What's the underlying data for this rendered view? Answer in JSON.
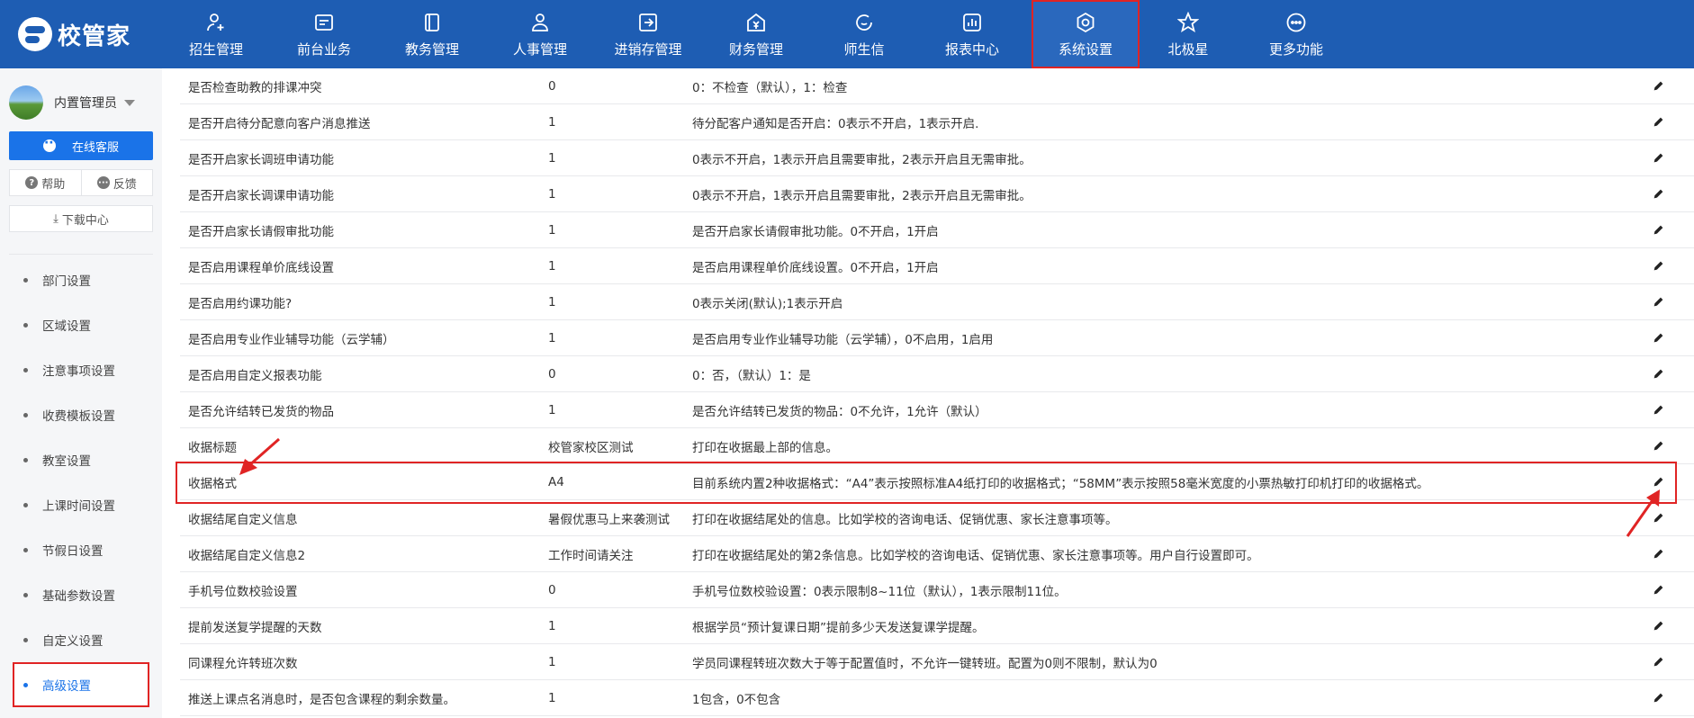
{
  "app": {
    "logo_text": "校管家"
  },
  "nav": [
    {
      "label": "招生管理",
      "icon": "user-add-icon"
    },
    {
      "label": "前台业务",
      "icon": "id-card-icon"
    },
    {
      "label": "教务管理",
      "icon": "book-icon"
    },
    {
      "label": "人事管理",
      "icon": "person-icon"
    },
    {
      "label": "进销存管理",
      "icon": "inventory-icon"
    },
    {
      "label": "财务管理",
      "icon": "finance-icon"
    },
    {
      "label": "师生信",
      "icon": "message-icon"
    },
    {
      "label": "报表中心",
      "icon": "report-icon"
    },
    {
      "label": "系统设置",
      "icon": "settings-icon",
      "active": true
    },
    {
      "label": "北极星",
      "icon": "star-icon"
    },
    {
      "label": "更多功能",
      "icon": "more-icon"
    }
  ],
  "sidebar": {
    "user_name": "内置管理员",
    "service_label": "在线客服",
    "help_label": "帮助",
    "feedback_label": "反馈",
    "download_label": "下载中心",
    "menu": [
      {
        "label": "部门设置"
      },
      {
        "label": "区域设置"
      },
      {
        "label": "注意事项设置"
      },
      {
        "label": "收费模板设置"
      },
      {
        "label": "教室设置"
      },
      {
        "label": "上课时间设置"
      },
      {
        "label": "节假日设置"
      },
      {
        "label": "基础参数设置"
      },
      {
        "label": "自定义设置"
      },
      {
        "label": "高级设置",
        "active": true
      }
    ]
  },
  "table": {
    "rows": [
      {
        "name": "是否检查助教的排课冲突",
        "value": "0",
        "desc": "0：不检查（默认），1：检查"
      },
      {
        "name": "是否开启待分配意向客户消息推送",
        "value": "1",
        "desc": "待分配客户通知是否开启：0表示不开启，1表示开启."
      },
      {
        "name": "是否开启家长调班申请功能",
        "value": "1",
        "desc": "0表示不开启，1表示开启且需要审批，2表示开启且无需审批。"
      },
      {
        "name": "是否开启家长调课申请功能",
        "value": "1",
        "desc": "0表示不开启，1表示开启且需要审批，2表示开启且无需审批。"
      },
      {
        "name": "是否开启家长请假审批功能",
        "value": "1",
        "desc": "是否开启家长请假审批功能。0不开启，1开启"
      },
      {
        "name": "是否启用课程单价底线设置",
        "value": "1",
        "desc": "是否启用课程单价底线设置。0不开启，1开启"
      },
      {
        "name": "是否启用约课功能?",
        "value": "1",
        "desc": "0表示关闭(默认);1表示开启"
      },
      {
        "name": "是否启用专业作业辅导功能（云学辅）",
        "value": "1",
        "desc": "是否启用专业作业辅导功能（云学辅），0不启用，1启用"
      },
      {
        "name": "是否启用自定义报表功能",
        "value": "0",
        "desc": "0：否，（默认）1：是"
      },
      {
        "name": "是否允许结转已发货的物品",
        "value": "1",
        "desc": "是否允许结转已发货的物品：0不允许，1允许（默认）"
      },
      {
        "name": "收据标题",
        "value": "校管家校区测试",
        "desc": "打印在收据最上部的信息。"
      },
      {
        "name": "收据格式",
        "value": "A4",
        "desc": "目前系统内置2种收据格式：“A4”表示按照标准A4纸打印的收据格式；“58MM”表示按照58毫米宽度的小票热敏打印机打印的收据格式。"
      },
      {
        "name": "收据结尾自定义信息",
        "value": "暑假优惠马上来袭测试",
        "desc": "打印在收据结尾处的信息。比如学校的咨询电话、促销优惠、家长注意事项等。"
      },
      {
        "name": "收据结尾自定义信息2",
        "value": "工作时间请关注",
        "desc": "打印在收据结尾处的第2条信息。比如学校的咨询电话、促销优惠、家长注意事项等。用户自行设置即可。"
      },
      {
        "name": "手机号位数校验设置",
        "value": "0",
        "desc": "手机号位数校验设置：0表示限制8~11位（默认），1表示限制11位。"
      },
      {
        "name": "提前发送复学提醒的天数",
        "value": "1",
        "desc": "根据学员“预计复课日期”提前多少天发送复课学提醒。"
      },
      {
        "name": "同课程允许转班次数",
        "value": "1",
        "desc": "学员同课程转班次数大于等于配置值时，不允许一键转班。配置为0则不限制，默认为0"
      },
      {
        "name": "推送上课点名消息时，是否包含课程的剩余数量。",
        "value": "1",
        "desc": "1包含，0不包含"
      }
    ]
  },
  "colors": {
    "nav_bg": "#1e5db3",
    "accent": "#1a73e8",
    "annotation": "#e02424"
  }
}
